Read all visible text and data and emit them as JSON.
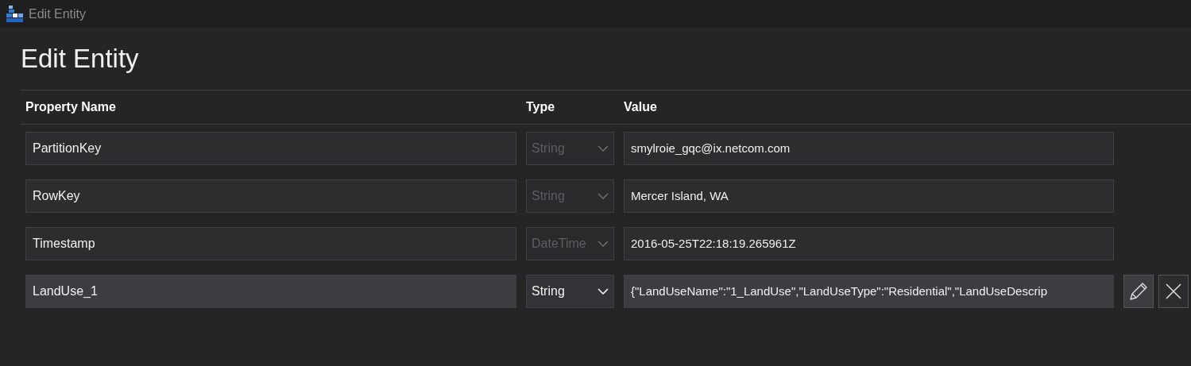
{
  "window": {
    "title": "Edit Entity"
  },
  "heading": "Edit Entity",
  "columns": [
    "Property Name",
    "Type",
    "Value"
  ],
  "rows": [
    {
      "name": "PartitionKey",
      "type": "String",
      "value": "smylroie_gqc@ix.netcom.com",
      "editable": false
    },
    {
      "name": "RowKey",
      "type": "String",
      "value": "Mercer Island, WA",
      "editable": false
    },
    {
      "name": "Timestamp",
      "type": "DateTime",
      "value": "2016-05-25T22:18:19.265961Z",
      "editable": false
    },
    {
      "name": "LandUse_1",
      "type": "String",
      "value": "{\"LandUseName\":\"1_LandUse\",\"LandUseType\":\"Residential\",\"LandUseDescrip",
      "editable": true
    }
  ]
}
